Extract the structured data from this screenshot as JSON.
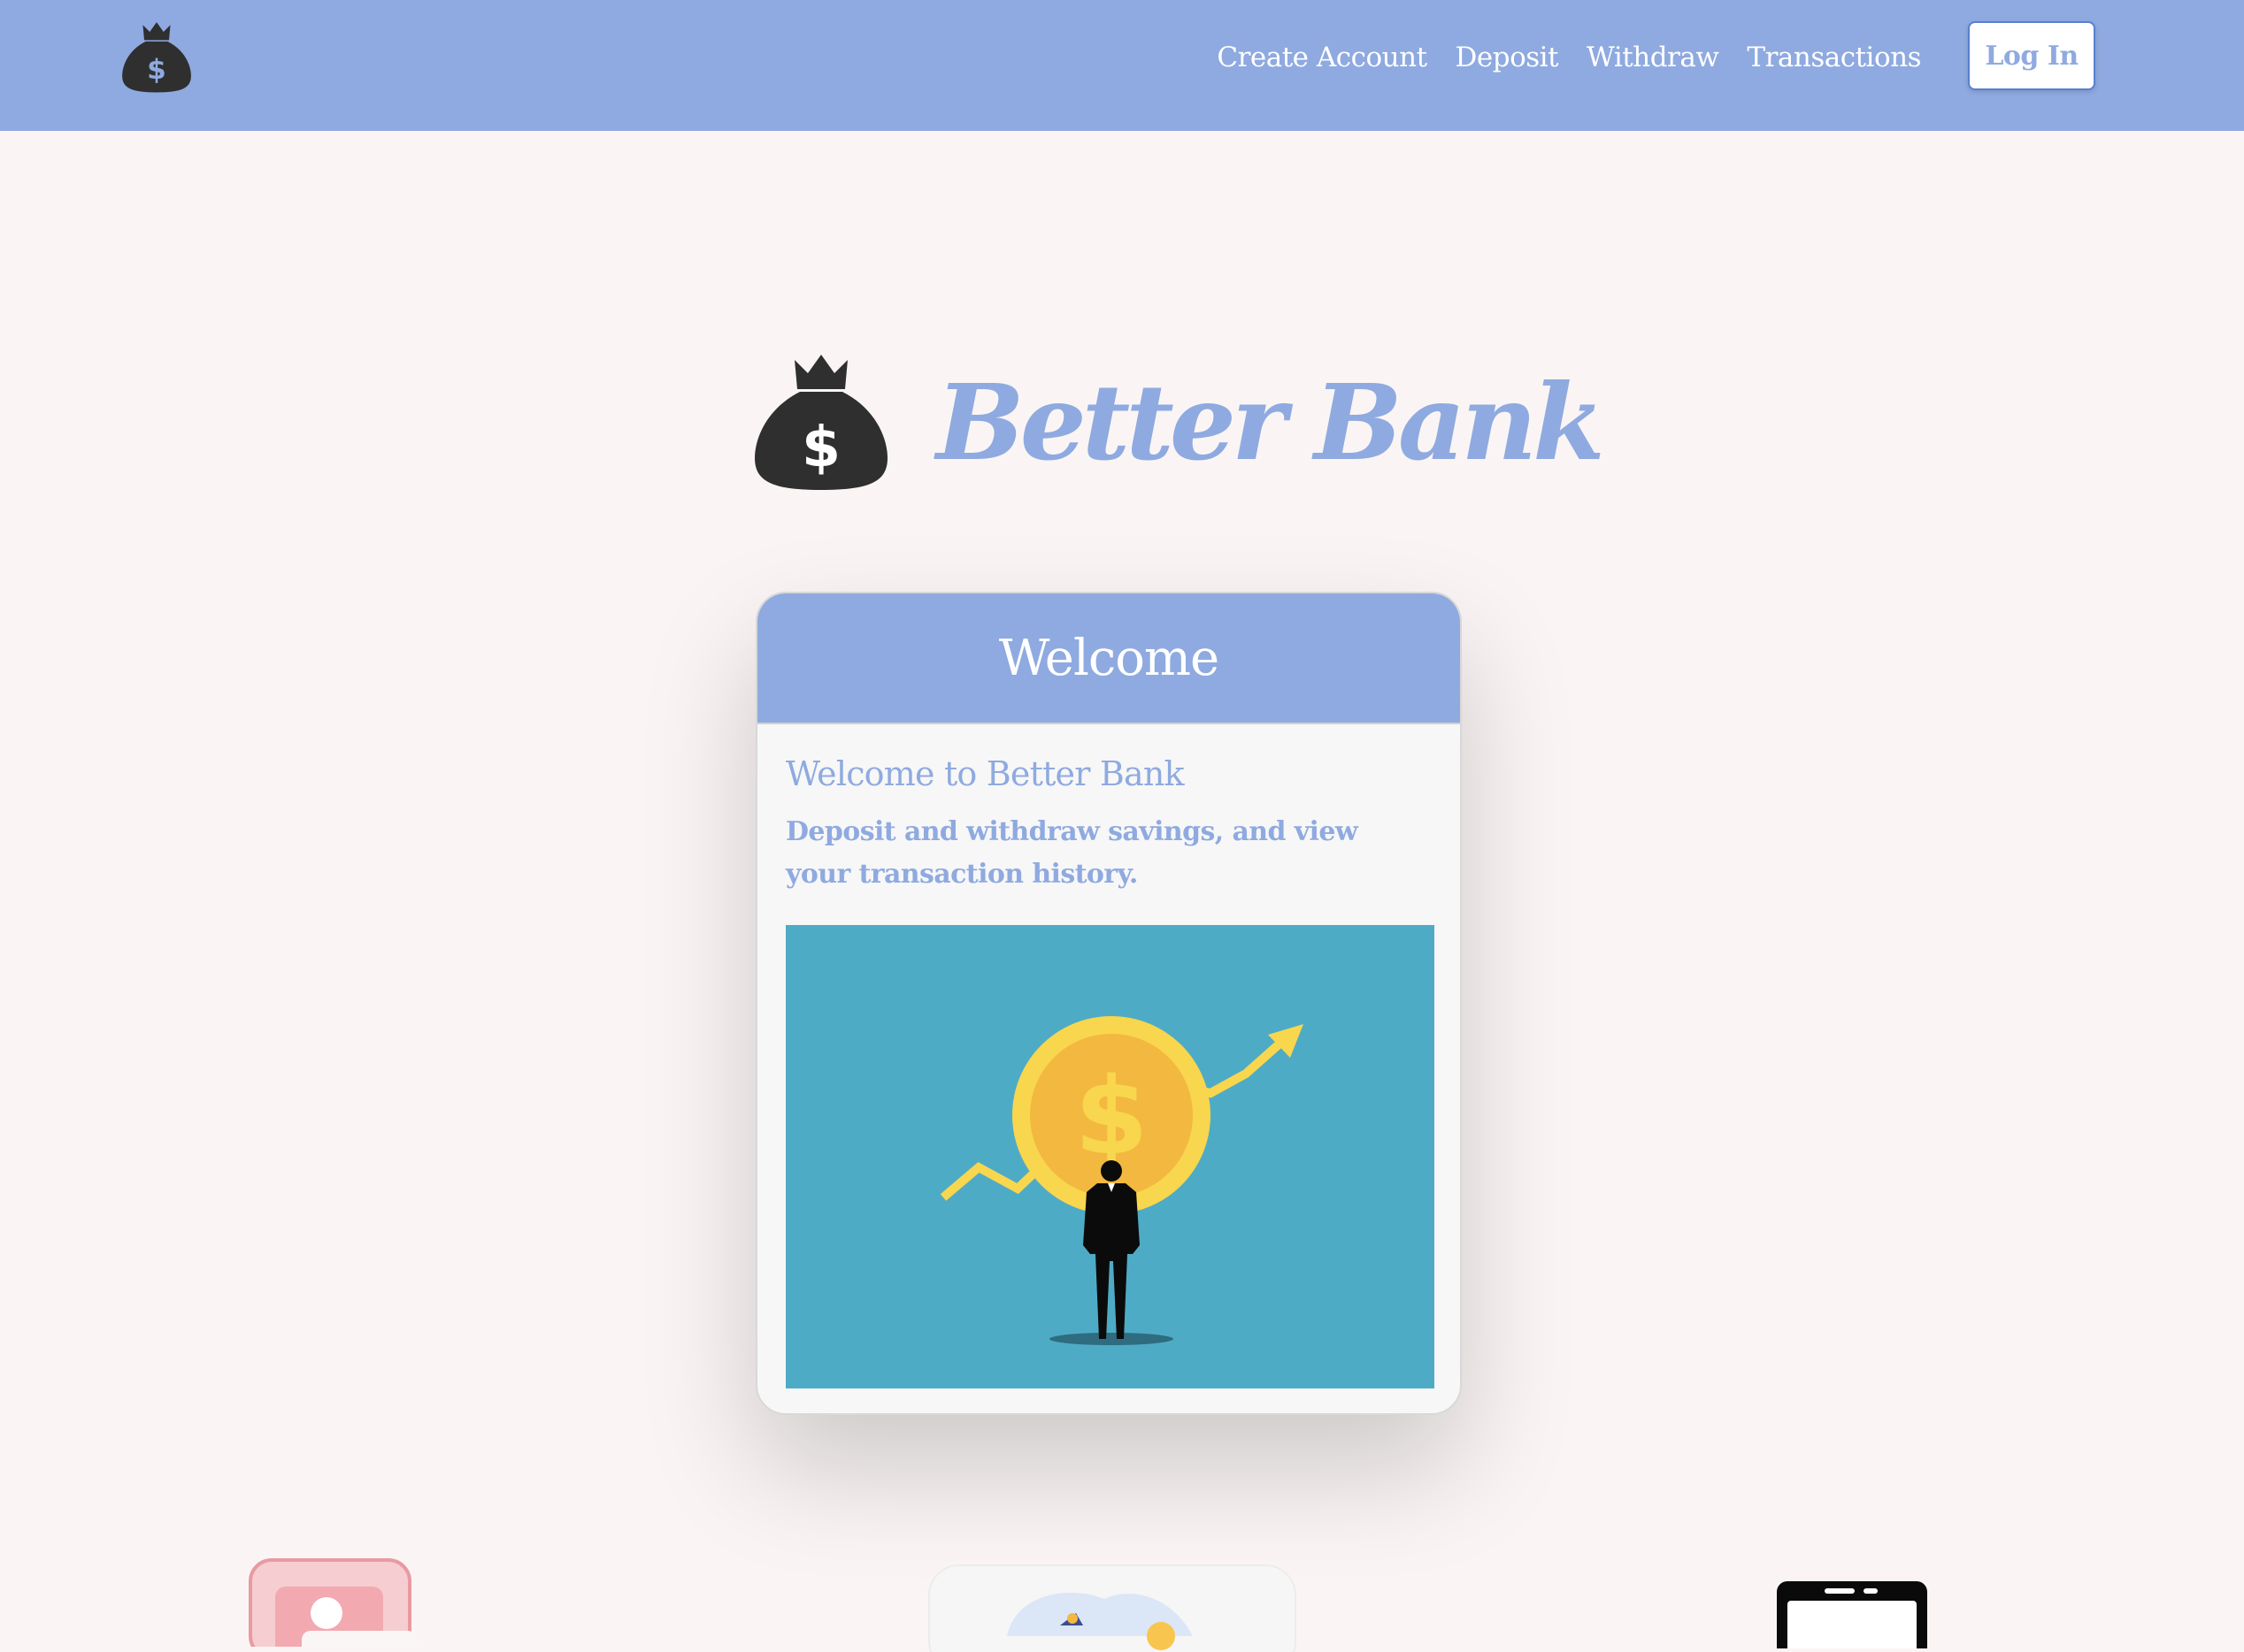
{
  "navbar": {
    "logo_icon": "money-bag-icon",
    "links": [
      "Create Account",
      "Deposit",
      "Withdraw",
      "Transactions"
    ],
    "login_label": "Log In",
    "background": "#8faae0"
  },
  "hero": {
    "logo_icon": "money-bag-icon",
    "title": "Better Bank"
  },
  "welcome_card": {
    "header": "Welcome",
    "title": "Welcome to Better Bank",
    "text": "Deposit and withdraw savings, and view your transaction history.",
    "image_icon": "coin-growth-illustration"
  },
  "bottom_features": [
    {
      "icon": "account-card-icon"
    },
    {
      "icon": "deposit-illustration-icon"
    },
    {
      "icon": "mobile-device-icon"
    }
  ],
  "colors": {
    "accent": "#8faae0",
    "page_background": "#faf5f4",
    "image_background": "#4eabc6",
    "coin": "#f8d64e"
  }
}
